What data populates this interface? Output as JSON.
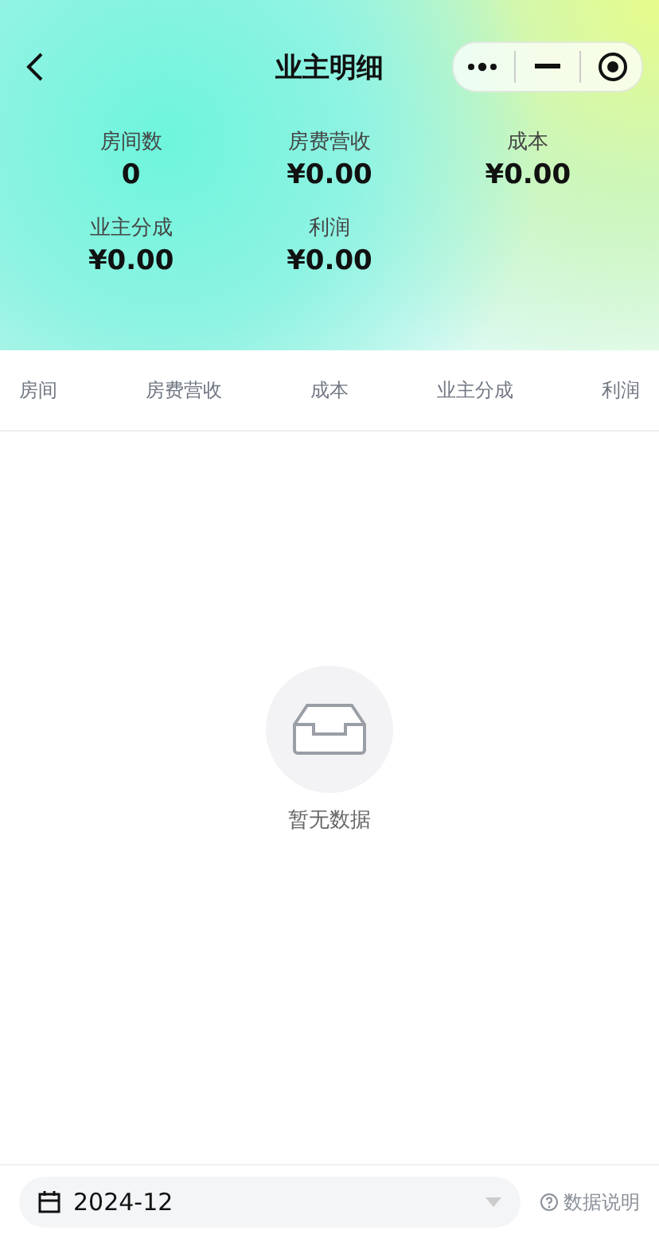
{
  "nav": {
    "title": "业主明细"
  },
  "stats": [
    {
      "label": "房间数",
      "value": "0"
    },
    {
      "label": "房费营收",
      "value": "¥0.00"
    },
    {
      "label": "成本",
      "value": "¥0.00"
    },
    {
      "label": "业主分成",
      "value": "¥0.00"
    },
    {
      "label": "利润",
      "value": "¥0.00"
    }
  ],
  "table": {
    "columns": [
      "房间",
      "房费营收",
      "成本",
      "业主分成",
      "利润"
    ]
  },
  "empty_state": {
    "text": "暂无数据"
  },
  "footer": {
    "month": "2024-12",
    "help": "数据说明"
  }
}
